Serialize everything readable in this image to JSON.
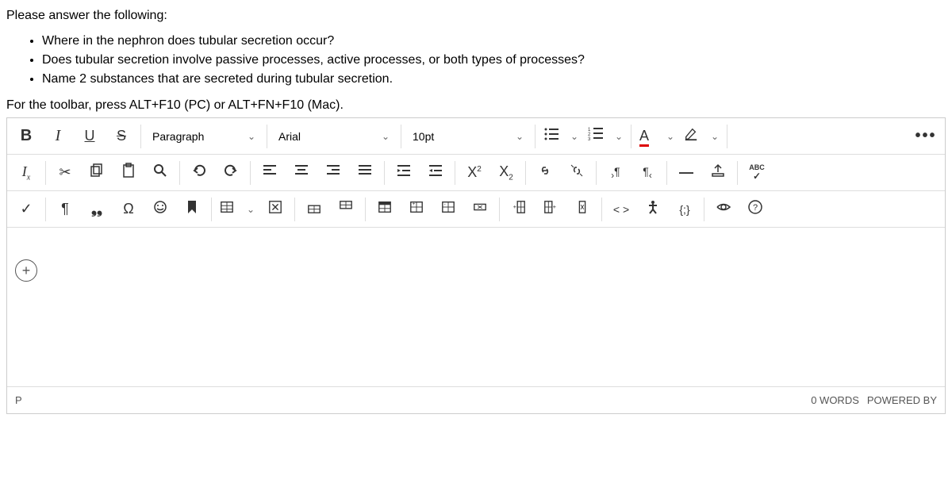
{
  "question": {
    "intro": "Please answer the following:",
    "bullets": [
      "Where in the nephron does tubular secretion occur?",
      "Does tubular secretion involve passive processes, active processes, or both types of processes?",
      "Name 2 substances that are secreted during tubular secretion."
    ],
    "hint": "For the toolbar, press ALT+F10 (PC) or ALT+FN+F10 (Mac)."
  },
  "toolbar": {
    "bold": "B",
    "italic": "I",
    "underline": "U",
    "strike": "S",
    "block_format": "Paragraph",
    "font_family": "Arial",
    "font_size": "10pt",
    "font_color": "A",
    "more": "•••",
    "clear_fmt": "Ix",
    "cut": "✂",
    "quote": "❝❞",
    "omega": "Ω",
    "emoji": "☺",
    "bookmark": "🔖",
    "sup": "X²",
    "sub": "X₂",
    "link": "🔗",
    "para_l": "¶",
    "para_r": "¶",
    "hr": "—",
    "check": "✓",
    "pilcrow": "¶",
    "abc": "ABC",
    "abc_check": "✓",
    "code": "< >",
    "access": "†",
    "css": "{;}",
    "preview": "👁",
    "help": "?"
  },
  "footer": {
    "path": "P",
    "words": "0 WORDS",
    "powered": "POWERED BY"
  }
}
